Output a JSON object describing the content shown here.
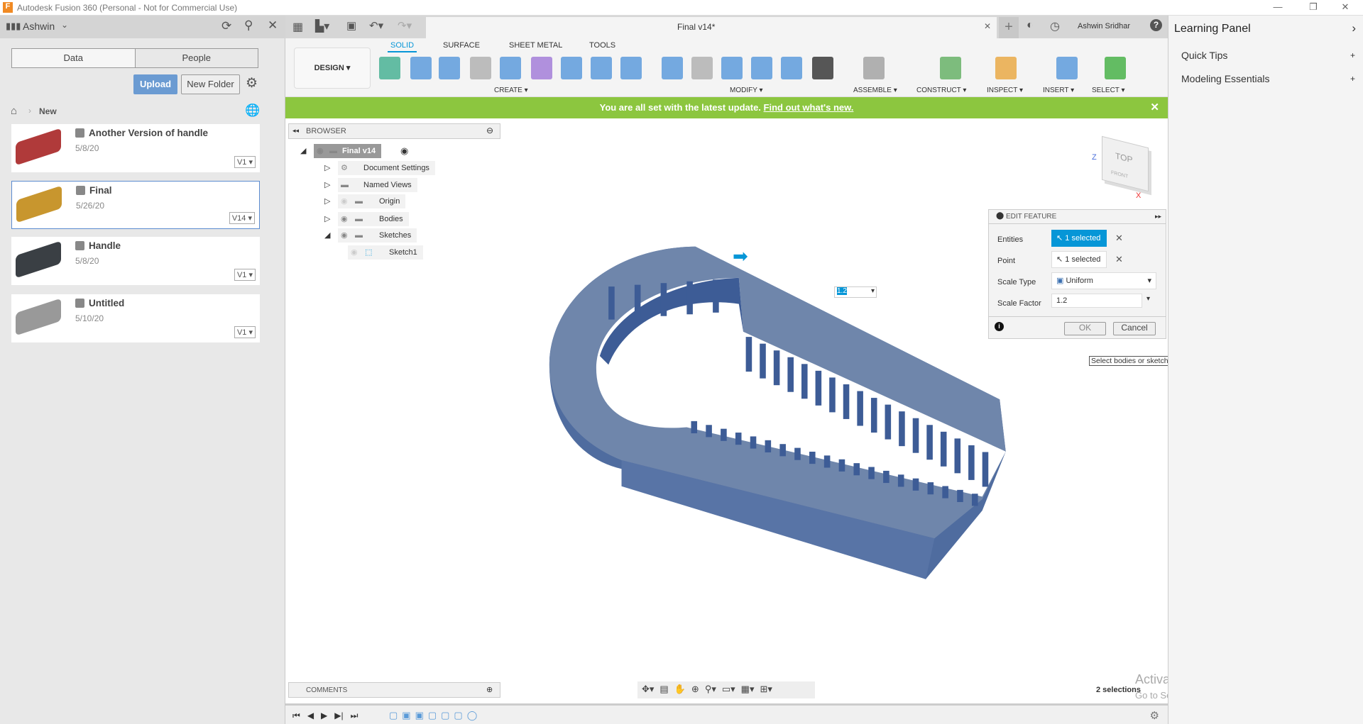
{
  "window": {
    "title": "Autodesk Fusion 360 (Personal - Not for Commercial Use)",
    "controls": [
      "—",
      "❐",
      "✕"
    ]
  },
  "data_panel": {
    "user": "Ashwin",
    "tabs": [
      "Data",
      "People"
    ],
    "upload": "Upload",
    "new_folder": "New Folder",
    "breadcrumb": "New",
    "files": [
      {
        "name": "Another Version of handle",
        "date": "5/8/20",
        "version": "V1",
        "thumb": "#b03a3a"
      },
      {
        "name": "Final",
        "date": "5/26/20",
        "version": "V14",
        "thumb": "#c8962e",
        "selected": true
      },
      {
        "name": "Handle",
        "date": "5/8/20",
        "version": "V1",
        "thumb": "#3a3f44"
      },
      {
        "name": "Untitled",
        "date": "5/10/20",
        "version": "V1",
        "thumb": "#999999"
      }
    ]
  },
  "document": {
    "tab_title": "Final v14*",
    "user": "Ashwin Sridhar"
  },
  "ribbon": {
    "workspace": "DESIGN",
    "tabs": [
      "SOLID",
      "SURFACE",
      "SHEET METAL",
      "TOOLS"
    ],
    "active_tab": "SOLID",
    "groups": [
      "CREATE",
      "MODIFY",
      "ASSEMBLE",
      "CONSTRUCT",
      "INSPECT",
      "INSERT",
      "SELECT"
    ]
  },
  "banner": {
    "text": "You are all set with the latest update.",
    "link": "Find out what's new."
  },
  "browser": {
    "title": "BROWSER",
    "items": [
      {
        "label": "Final v14"
      },
      {
        "label": "Document Settings"
      },
      {
        "label": "Named Views"
      },
      {
        "label": "Origin"
      },
      {
        "label": "Bodies"
      },
      {
        "label": "Sketches"
      },
      {
        "label": "Sketch1"
      }
    ]
  },
  "viewcube": {
    "top": "TOP",
    "front": "FRONT",
    "axes": [
      "Z",
      "X"
    ]
  },
  "edit_feature": {
    "title": "EDIT FEATURE",
    "entities_label": "Entities",
    "entities_value": "1 selected",
    "point_label": "Point",
    "point_value": "1 selected",
    "scale_type_label": "Scale Type",
    "scale_type_value": "Uniform",
    "scale_factor_label": "Scale Factor",
    "scale_factor_value": "1.2",
    "ok": "OK",
    "cancel": "Cancel",
    "tooltip": "Select bodies or sketches to scale"
  },
  "canvas": {
    "inline_value": "1.2",
    "status": "2 selections",
    "comments": "COMMENTS",
    "watermark_title": "Activate Windows",
    "watermark_sub": "Go to Settings to activate Windows.",
    "model_color": "#6f86ab",
    "accent": "#0696d7"
  },
  "learning_panel": {
    "title": "Learning Panel",
    "items": [
      "Quick Tips",
      "Modeling Essentials"
    ]
  }
}
